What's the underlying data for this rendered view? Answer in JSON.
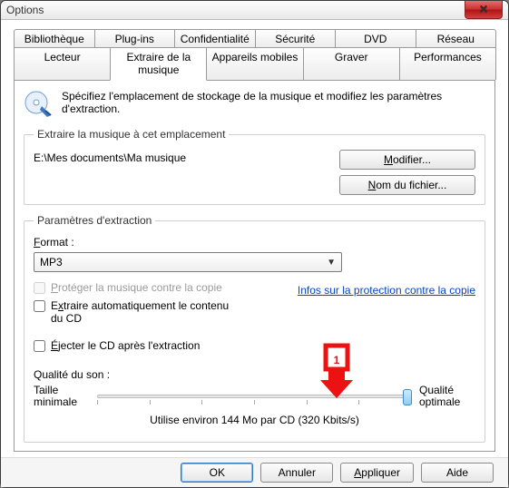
{
  "window": {
    "title": "Options"
  },
  "tabs_row1": [
    "Bibliothèque",
    "Plug-ins",
    "Confidentialité",
    "Sécurité",
    "DVD",
    "Réseau"
  ],
  "tabs_row2": [
    "Lecteur",
    "Extraire de la musique",
    "Appareils mobiles",
    "Graver",
    "Performances"
  ],
  "active_tab": "Extraire de la musique",
  "intro": "Spécifiez l'emplacement de stockage de la musique et modifiez les paramètres d'extraction.",
  "location": {
    "legend": "Extraire la musique à cet emplacement",
    "path": "E:\\Mes documents\\Ma musique",
    "modify_btn": "Modifier...",
    "filename_btn": "Nom du fichier..."
  },
  "settings": {
    "legend": "Paramètres d'extraction",
    "format_label": "Format :",
    "format_value": "MP3",
    "protect_label": "Protéger la musique contre la copie",
    "protect_enabled": false,
    "copy_link": "Infos sur la protection contre la copie",
    "autorip_label": "Extraire automatiquement le contenu du CD",
    "autorip_checked": false,
    "eject_label": "Éjecter le CD après l'extraction",
    "eject_checked": false,
    "quality_label": "Qualité du son :",
    "slider_left": "Taille minimale",
    "slider_right": "Qualité optimale",
    "slider_pos_percent": 100,
    "slider_info": "Utilise environ 144 Mo par CD (320 Kbits/s)"
  },
  "annotation": {
    "label": "1",
    "color": "#e11"
  },
  "footer": {
    "ok": "OK",
    "cancel": "Annuler",
    "apply": "Appliquer",
    "help": "Aide"
  }
}
